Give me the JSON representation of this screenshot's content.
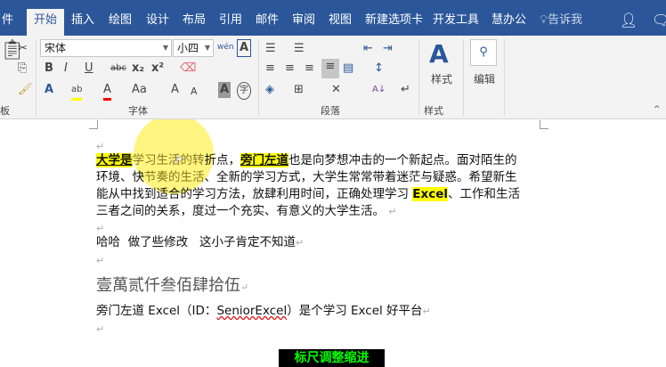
{
  "tabs": [
    "件",
    "开始",
    "插入",
    "绘图",
    "设计",
    "布局",
    "引用",
    "邮件",
    "审阅",
    "视图",
    "新建选项卡",
    "开发工具",
    "慧办公"
  ],
  "active_tab": "开始",
  "tell_me": "告诉我",
  "ribbon": {
    "font_name": "宋体",
    "font_size": "小四",
    "groups": {
      "clipboard": "板",
      "font": "字体",
      "paragraph": "段落",
      "styles": "样式",
      "editing": "编辑"
    },
    "styles_button": "样式",
    "editing_button": "编辑",
    "font_buttons": {
      "bold": "B",
      "italic": "I",
      "underline": "U",
      "strike": "abc",
      "subscript": "x₂",
      "superscript": "x²",
      "phonetic": "wén",
      "case": "Aa",
      "grow": "A",
      "shrink": "A",
      "shade": "A",
      "enclose": "字",
      "border": "A"
    },
    "colors": {
      "highlight": "#ffff00",
      "font_color": "#ff0000",
      "accent": "#2b579a"
    }
  },
  "document": {
    "para1": {
      "h1": "大学是",
      "f1": "学习生活的转",
      "t1": "折点，",
      "h2": "旁门左道",
      "t2": "也是向梦想冲击的一个新起点。面对陌生的"
    },
    "line2": {
      "a": "环境、快",
      "f": "节奏的生活",
      "b": "、全新的学习方式，大学生常常带着迷茫与疑惑。希望新生"
    },
    "line3": {
      "a": "能从中找到适合的学习方法，放肆利用时间，正确处理学习 ",
      "h": "Excel",
      "b": "、工作和生活"
    },
    "line4": "三者之间的关系，度过一个充实、有意义的大学生活。",
    "para2": "哈哈  做了些修改   这小子肯定不知道",
    "para3": "壹萬贰仟叁佰肆拾伍",
    "para4": {
      "a": "旁门左道 Excel（ID：",
      "id": "SeniorExcel",
      "b": "）是个学习 Excel 好平台"
    },
    "para_mark": "↵"
  },
  "caption": "标尺调整缩进"
}
